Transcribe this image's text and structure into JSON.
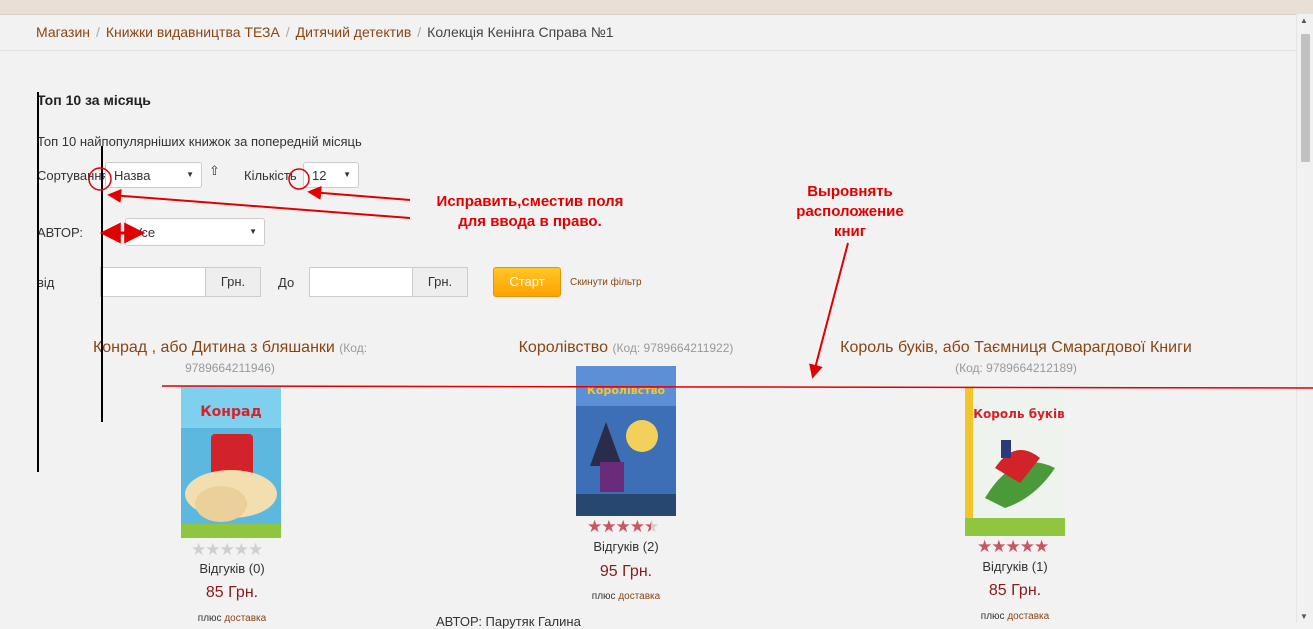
{
  "breadcrumb": {
    "items": [
      "Магазин",
      "Книжки видавництва ТЕЗА",
      "Дитячий детектив"
    ],
    "current": "Колекція Кенінга Справа №1"
  },
  "section": {
    "title": "Топ 10 за місяць",
    "subtitle": "Топ 10 найпопулярніших книжок за попередній місяць"
  },
  "filters": {
    "sort_label": "Сортування",
    "sort_value": "Назва",
    "count_label": "Кількість",
    "count_value": "12",
    "author_label": "АВТОР:",
    "author_value": "Усе",
    "from_label": "від",
    "to_label": "До",
    "currency": "Грн.",
    "start_button": "Старт",
    "reset_link": "Скинути фільтр"
  },
  "products": [
    {
      "title": "Конрад , або Дитина з бляшанки",
      "code": "(Код: 9789664211946)",
      "rating": 0,
      "reviews": "Відгуків (0)",
      "price": "85 Грн.",
      "delivery_prefix": "плюс",
      "delivery_link": "доставка",
      "cover_title": "Конрад"
    },
    {
      "title": "Королівство",
      "code": "(Код: 9789664211922)",
      "rating": 4.5,
      "reviews": "Відгуків (2)",
      "price": "95 Грн.",
      "delivery_prefix": "плюс",
      "delivery_link": "доставка",
      "cover_title": "Королівство"
    },
    {
      "title": "Король буків, або Таємниця Смарагдової Книги",
      "code": "(Код: 9789664212189)",
      "rating": 5,
      "reviews": "Відгуків (1)",
      "price": "85 Грн.",
      "delivery_prefix": "плюс",
      "delivery_link": "доставка",
      "cover_title": "Король буків"
    }
  ],
  "author_line": "АВТОР: Парутяк Галина",
  "annotations": {
    "note1": [
      "Исправить,сместив поля",
      "для ввода в право."
    ],
    "note2": [
      "Выровнять",
      "расположение",
      "книг"
    ],
    "color": "#e00000"
  },
  "colors": {
    "link": "#8b4513",
    "price": "#8b1a1a",
    "star_on": "#c9555f",
    "start_button": "#ffb300"
  }
}
